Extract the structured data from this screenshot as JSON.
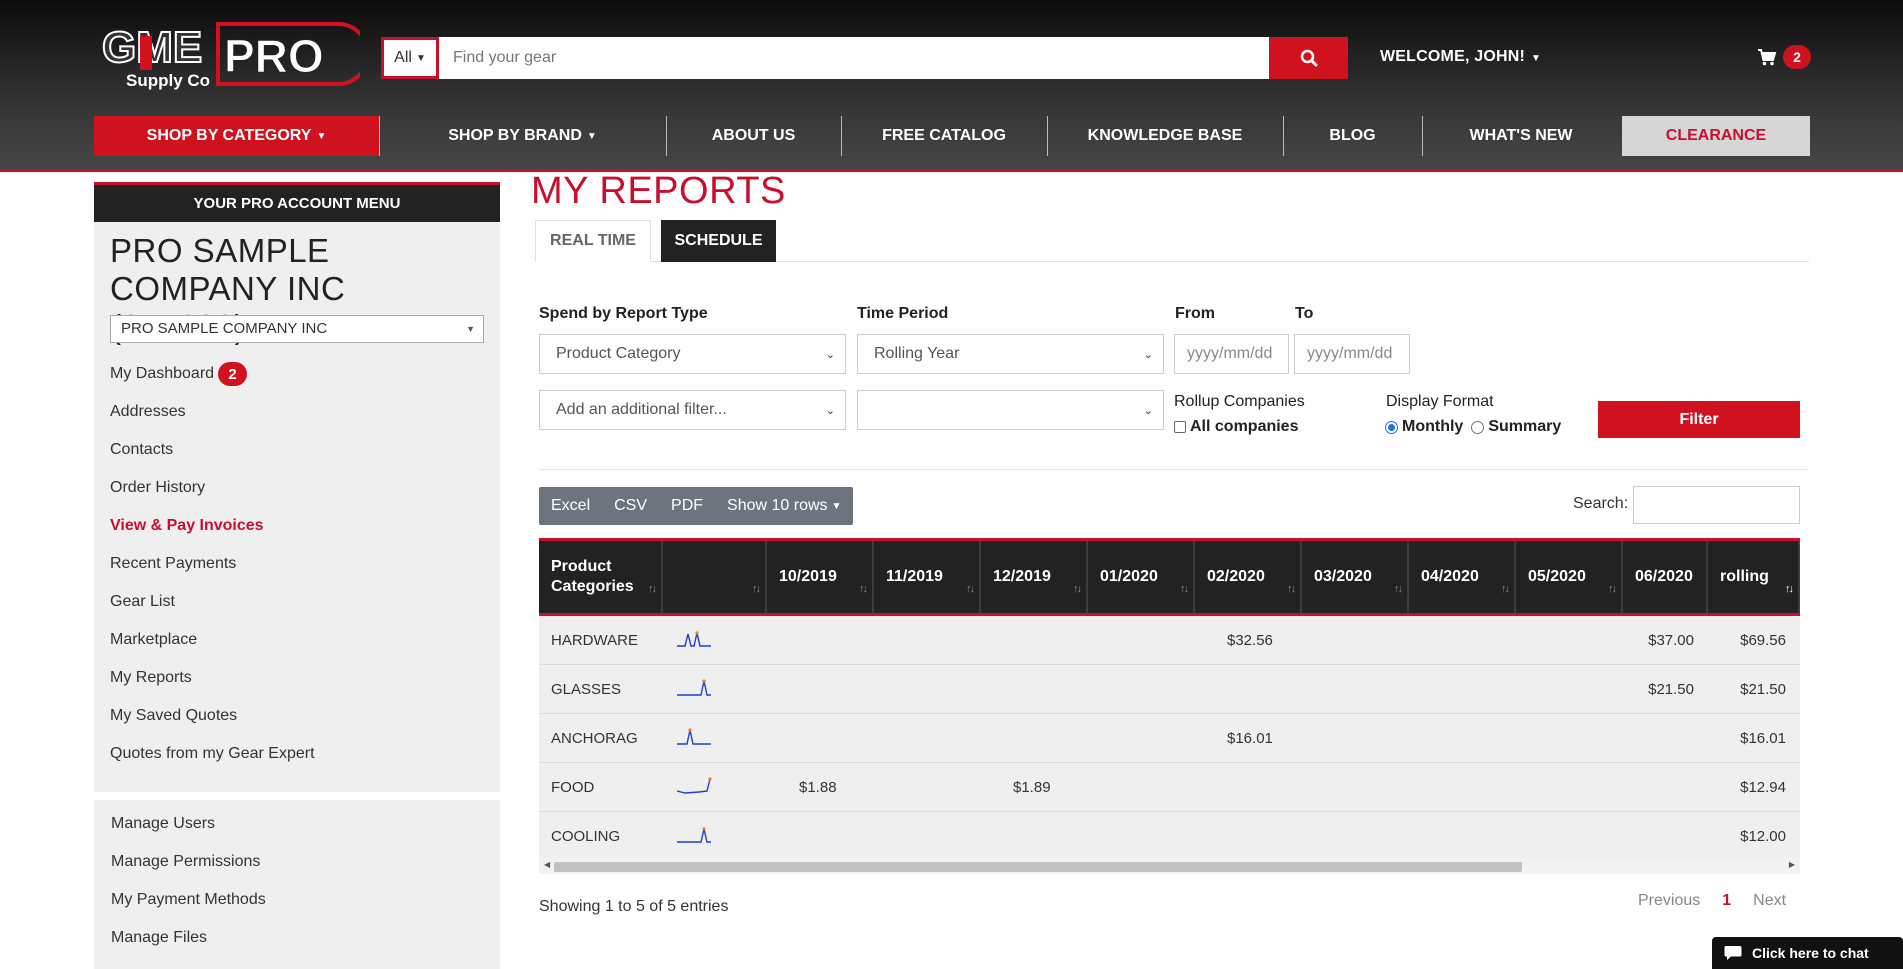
{
  "header": {
    "logo": {
      "brand": "GME",
      "pro": "PRO",
      "sub": "Supply Co"
    },
    "search": {
      "category": "All",
      "placeholder": "Find your gear"
    },
    "welcome": "WELCOME, JOHN!",
    "cart_count": "2",
    "nav": [
      {
        "label": "SHOP BY CATEGORY",
        "caret": true
      },
      {
        "label": "SHOP BY BRAND",
        "caret": true
      },
      {
        "label": "ABOUT US"
      },
      {
        "label": "FREE CATALOG"
      },
      {
        "label": "KNOWLEDGE BASE"
      },
      {
        "label": "BLOG"
      },
      {
        "label": "WHAT'S NEW"
      },
      {
        "label": "CLEARANCE"
      }
    ]
  },
  "sidebar": {
    "heading": "YOUR PRO ACCOUNT MENU",
    "company": "PRO SAMPLE COMPANY INC (247633)",
    "company_select": "PRO SAMPLE COMPANY INC",
    "items": [
      {
        "label": "My Dashboard",
        "badge": "2"
      },
      {
        "label": "Addresses"
      },
      {
        "label": "Contacts"
      },
      {
        "label": "Order History"
      },
      {
        "label": "View & Pay Invoices",
        "active": true
      },
      {
        "label": "Recent Payments"
      },
      {
        "label": "Gear List"
      },
      {
        "label": "Marketplace"
      },
      {
        "label": "My Reports"
      },
      {
        "label": "My Saved Quotes"
      },
      {
        "label": "Quotes from my Gear Expert"
      }
    ],
    "admin_items": [
      {
        "label": "Manage Users"
      },
      {
        "label": "Manage Permissions"
      },
      {
        "label": "My Payment Methods"
      },
      {
        "label": "Manage Files"
      }
    ]
  },
  "main": {
    "title": "MY REPORTS",
    "tabs": [
      "REAL TIME",
      "SCHEDULE"
    ],
    "filters": {
      "report_type_label": "Spend by Report Type",
      "report_type_value": "Product Category",
      "time_period_label": "Time Period",
      "time_period_value": "Rolling Year",
      "from_label": "From",
      "to_label": "To",
      "from_placeholder": "yyyy/mm/dd",
      "to_placeholder": "yyyy/mm/dd",
      "additional_filter": "Add an additional filter...",
      "secondary_value": "",
      "rollup_label": "Rollup Companies",
      "all_companies": "All companies",
      "display_label": "Display Format",
      "monthly": "Monthly",
      "summary": "Summary",
      "filter_button": "Filter"
    },
    "toolbar": {
      "excel": "Excel",
      "csv": "CSV",
      "pdf": "PDF",
      "show_rows": "Show 10 rows",
      "search_label": "Search:"
    },
    "table": {
      "columns": [
        "Product Categories",
        "",
        "10/2019",
        "11/2019",
        "12/2019",
        "01/2020",
        "02/2020",
        "03/2020",
        "04/2020",
        "05/2020",
        "06/2020",
        "rolling"
      ],
      "rows": [
        {
          "name": "HARDWARE",
          "cells": [
            "",
            "",
            "",
            "",
            "$32.56",
            "",
            "",
            "",
            "$37.00",
            "$69.56"
          ]
        },
        {
          "name": "GLASSES",
          "cells": [
            "",
            "",
            "",
            "",
            "",
            "",
            "",
            "",
            "$21.50",
            "$21.50"
          ]
        },
        {
          "name": "ANCHORAG",
          "cells": [
            "",
            "",
            "",
            "",
            "$16.01",
            "",
            "",
            "",
            "",
            "$16.01"
          ]
        },
        {
          "name": "FOOD",
          "cells": [
            "$1.88",
            "",
            "$1.89",
            "",
            "",
            "",
            "",
            "",
            "",
            "$12.94"
          ]
        },
        {
          "name": "COOLING",
          "cells": [
            "",
            "",
            "",
            "",
            "",
            "",
            "",
            "",
            "",
            "$12.00"
          ]
        }
      ]
    },
    "footer": {
      "showing": "Showing 1 to 5 of 5 entries",
      "previous": "Previous",
      "page": "1",
      "next": "Next"
    }
  },
  "chat": {
    "label": "Click here to chat"
  },
  "colors": {
    "brand_red": "#d0121f",
    "dark": "#222222",
    "sidebar_bg": "#efefef"
  }
}
